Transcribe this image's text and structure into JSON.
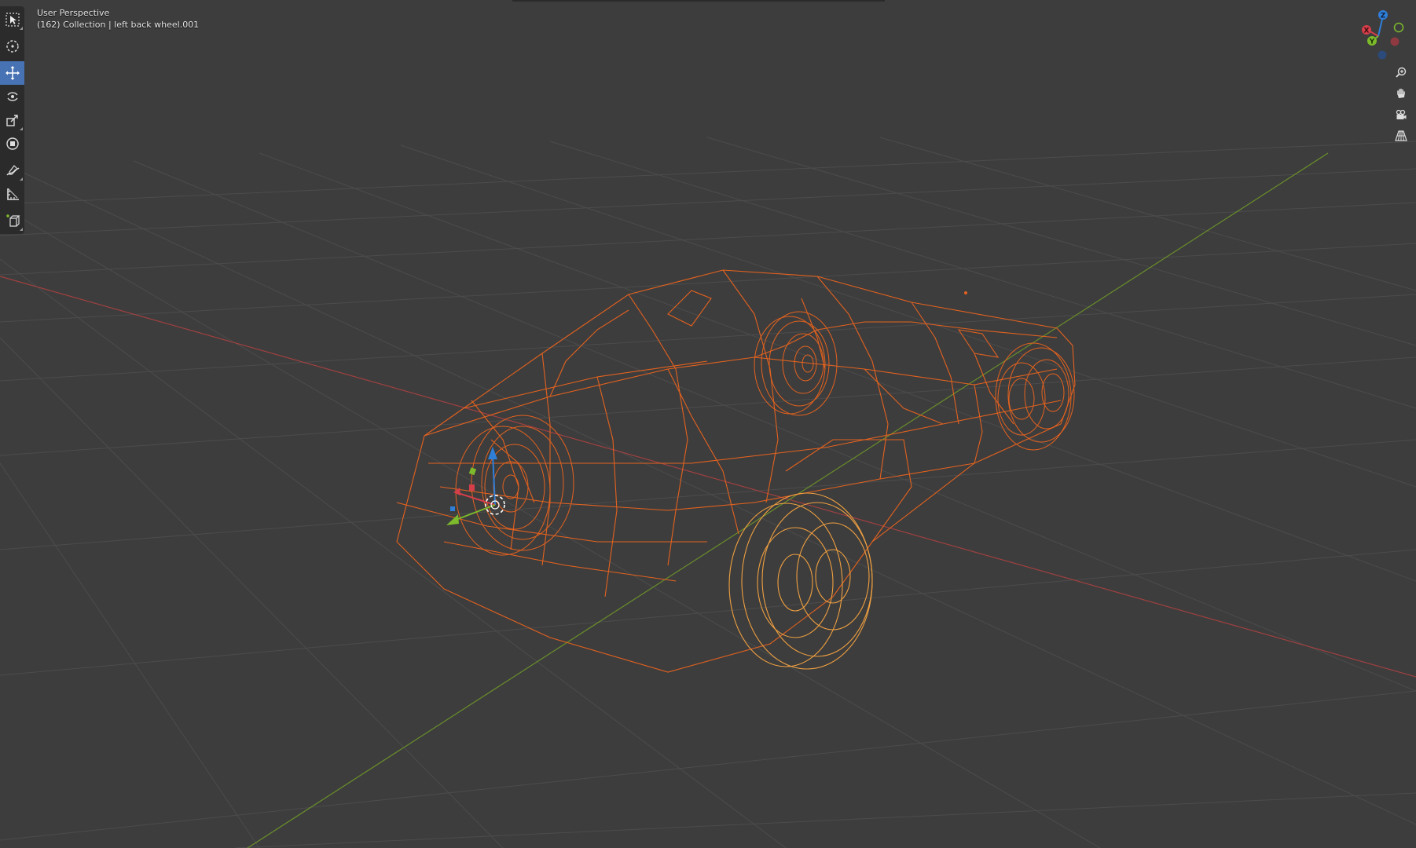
{
  "viewport": {
    "view_name": "User Perspective",
    "object_info": "(162) Collection | left back wheel.001"
  },
  "toolbar": {
    "tools": [
      {
        "name": "select-box-tool",
        "icon": "select-box-icon",
        "active": false
      },
      {
        "name": "cursor-tool",
        "icon": "cursor-icon",
        "active": false
      },
      {
        "name": "move-tool",
        "icon": "move-icon",
        "active": true
      },
      {
        "name": "rotate-tool",
        "icon": "rotate-icon",
        "active": false
      },
      {
        "name": "scale-tool",
        "icon": "scale-icon",
        "active": false
      },
      {
        "name": "transform-tool",
        "icon": "transform-icon",
        "active": false
      },
      {
        "name": "annotate-tool",
        "icon": "annotate-icon",
        "active": false
      },
      {
        "name": "measure-tool",
        "icon": "measure-icon",
        "active": false
      },
      {
        "name": "add-cube-tool",
        "icon": "add-cube-icon",
        "active": false
      }
    ]
  },
  "gizmo": {
    "z_label": "Z",
    "y_label": "Y",
    "x_label": "X"
  },
  "nav": {
    "buttons": [
      "zoom-icon",
      "pan-hand-icon",
      "camera-icon",
      "perspective-grid-icon"
    ]
  },
  "colors": {
    "background": "#3d3d3d",
    "grid": "#4a4a4a",
    "x_axis": "#a04040",
    "y_axis": "#6a8f2a",
    "selected_wire": "#e4621f",
    "active_wire": "#f0a040",
    "toolbar_active": "#4772b3",
    "gizmo_x": "#d63e4a",
    "gizmo_y": "#7dbb2c",
    "gizmo_z": "#2f7fd9"
  }
}
